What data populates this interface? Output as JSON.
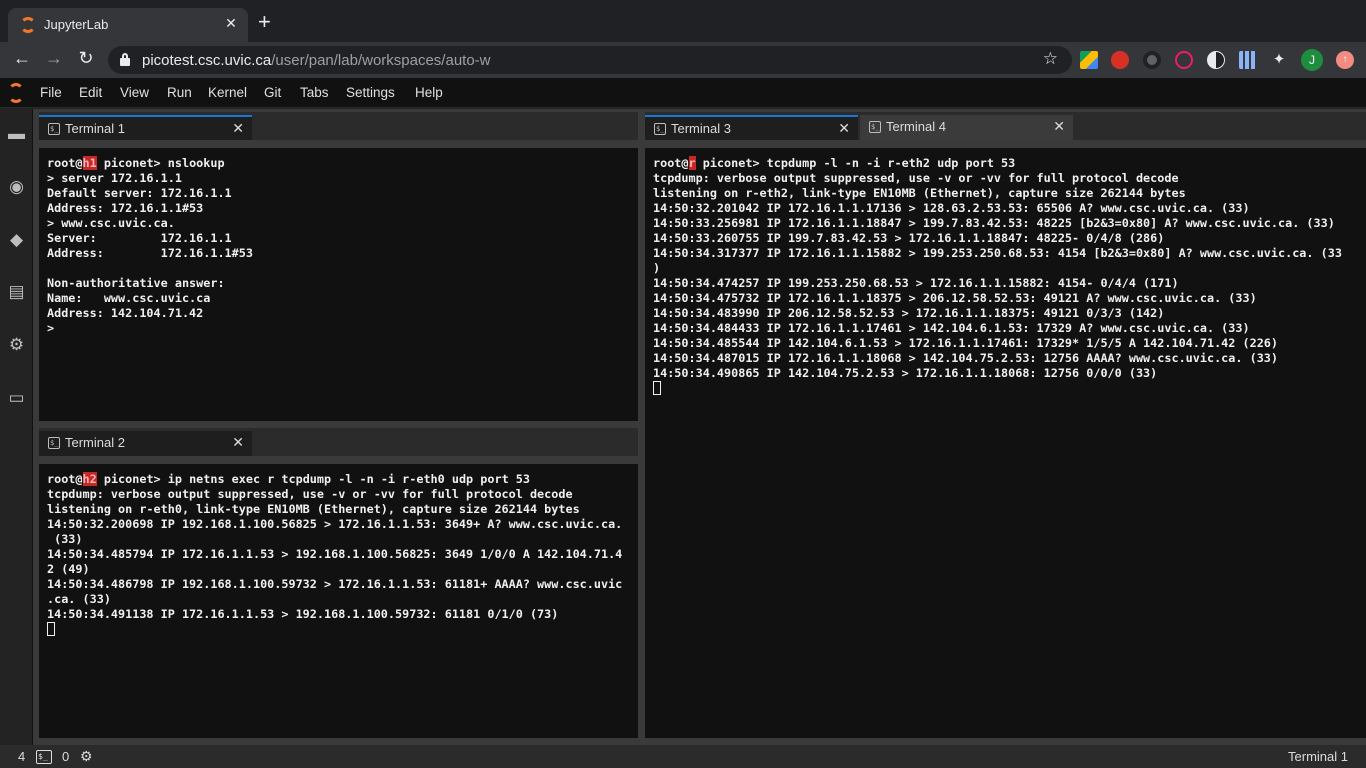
{
  "browser": {
    "tab_title": "JupyterLab",
    "url_host": "picotest.csc.uvic.ca",
    "url_path": "/user/pan/lab/workspaces/auto-w",
    "profile_initial": "J"
  },
  "menu": [
    "File",
    "Edit",
    "View",
    "Run",
    "Kernel",
    "Git",
    "Tabs",
    "Settings",
    "Help"
  ],
  "tabs": {
    "t1": "Terminal 1",
    "t2": "Terminal 2",
    "t3": "Terminal 3",
    "t4": "Terminal 4"
  },
  "terminal1": {
    "prompt_user": "root@",
    "prompt_host": "h1",
    "prompt_rest": " piconet> nslookup",
    "lines": [
      "> server 172.16.1.1",
      "Default server: 172.16.1.1",
      "Address: 172.16.1.1#53",
      "> www.csc.uvic.ca.",
      "Server:         172.16.1.1",
      "Address:        172.16.1.1#53",
      "",
      "Non-authoritative answer:",
      "Name:   www.csc.uvic.ca",
      "Address: 142.104.71.42",
      ">"
    ]
  },
  "terminal2": {
    "prompt_user": "root@",
    "prompt_host": "h2",
    "prompt_rest": " piconet> ip netns exec r tcpdump -l -n -i r-eth0 udp port 53",
    "lines": [
      "tcpdump: verbose output suppressed, use -v or -vv for full protocol decode",
      "listening on r-eth0, link-type EN10MB (Ethernet), capture size 262144 bytes",
      "14:50:32.200698 IP 192.168.1.100.56825 > 172.16.1.1.53: 3649+ A? www.csc.uvic.ca.",
      " (33)",
      "14:50:34.485794 IP 172.16.1.1.53 > 192.168.1.100.56825: 3649 1/0/0 A 142.104.71.4",
      "2 (49)",
      "14:50:34.486798 IP 192.168.1.100.59732 > 172.16.1.1.53: 61181+ AAAA? www.csc.uvic",
      ".ca. (33)",
      "14:50:34.491138 IP 172.16.1.1.53 > 192.168.1.100.59732: 61181 0/1/0 (73)"
    ]
  },
  "terminal3": {
    "prompt_user": "root@",
    "prompt_host": "r",
    "prompt_rest": " piconet> tcpdump -l -n -i r-eth2 udp port 53",
    "lines": [
      "tcpdump: verbose output suppressed, use -v or -vv for full protocol decode",
      "listening on r-eth2, link-type EN10MB (Ethernet), capture size 262144 bytes",
      "14:50:32.201042 IP 172.16.1.1.17136 > 128.63.2.53.53: 65506 A? www.csc.uvic.ca. (33)",
      "14:50:33.256981 IP 172.16.1.1.18847 > 199.7.83.42.53: 48225 [b2&3=0x80] A? www.csc.uvic.ca. (33)",
      "14:50:33.260755 IP 199.7.83.42.53 > 172.16.1.1.18847: 48225- 0/4/8 (286)",
      "14:50:34.317377 IP 172.16.1.1.15882 > 199.253.250.68.53: 4154 [b2&3=0x80] A? www.csc.uvic.ca. (33",
      ")",
      "14:50:34.474257 IP 199.253.250.68.53 > 172.16.1.1.15882: 4154- 0/4/4 (171)",
      "14:50:34.475732 IP 172.16.1.1.18375 > 206.12.58.52.53: 49121 A? www.csc.uvic.ca. (33)",
      "14:50:34.483990 IP 206.12.58.52.53 > 172.16.1.1.18375: 49121 0/3/3 (142)",
      "14:50:34.484433 IP 172.16.1.1.17461 > 142.104.6.1.53: 17329 A? www.csc.uvic.ca. (33)",
      "14:50:34.485544 IP 142.104.6.1.53 > 172.16.1.1.17461: 17329* 1/5/5 A 142.104.71.42 (226)",
      "14:50:34.487015 IP 172.16.1.1.18068 > 142.104.75.2.53: 12756 AAAA? www.csc.uvic.ca. (33)",
      "14:50:34.490865 IP 142.104.75.2.53 > 172.16.1.1.18068: 12756 0/0/0 (33)"
    ]
  },
  "status": {
    "terminals_count": "4",
    "kernels_count": "0",
    "active": "Terminal 1"
  }
}
